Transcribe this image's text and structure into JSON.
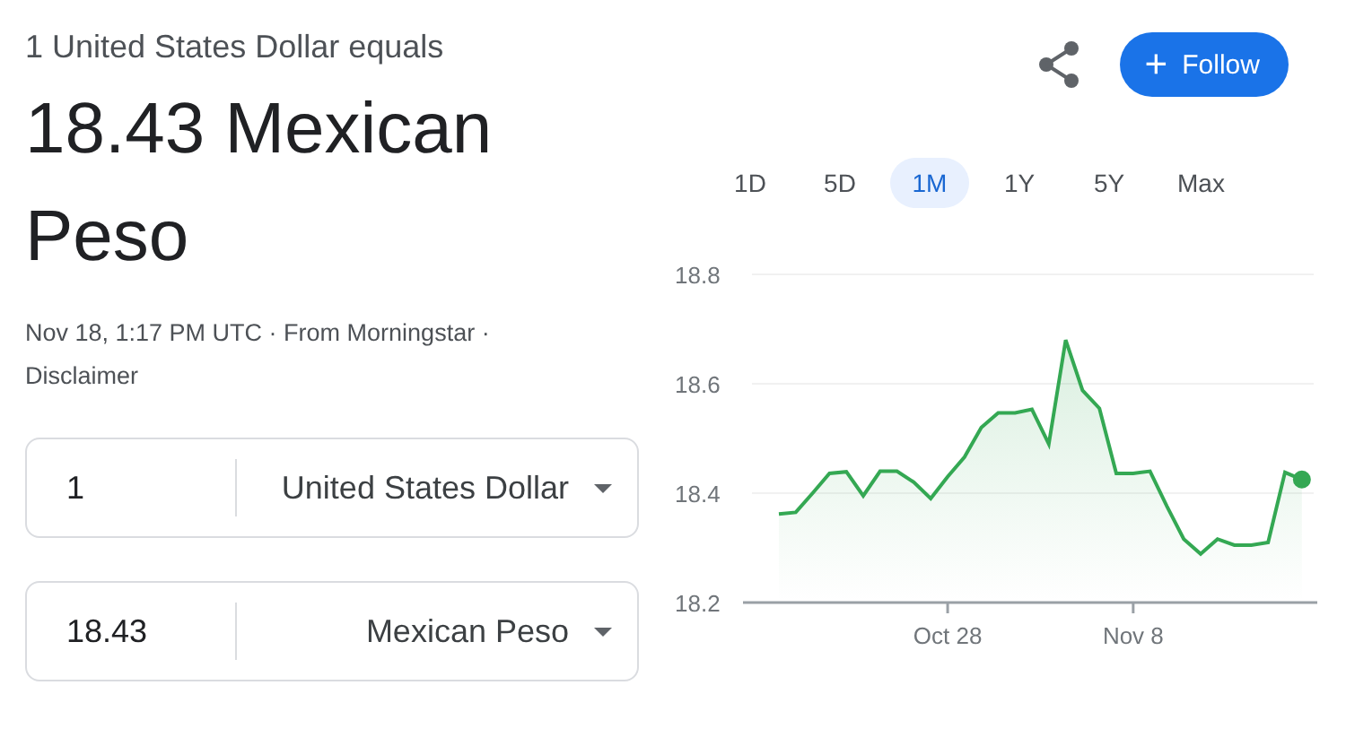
{
  "header": {
    "subtitle": "1 United States Dollar equals",
    "rate": "18.43 Mexican Peso"
  },
  "follow_button": {
    "icon": "+",
    "label": "Follow"
  },
  "source": {
    "text": "Nov 18, 1:17 PM UTC · From Morningstar ·",
    "link": "Disclaimer"
  },
  "converter": [
    {
      "amount": "1",
      "currency": "United States Dollar"
    },
    {
      "amount": "18.43",
      "currency": "Mexican Peso"
    }
  ],
  "ranges": [
    {
      "label": "1D",
      "selected": false
    },
    {
      "label": "5D",
      "selected": false
    },
    {
      "label": "1M",
      "selected": true
    },
    {
      "label": "1Y",
      "selected": false
    },
    {
      "label": "5Y",
      "selected": false
    },
    {
      "label": "Max",
      "selected": false
    }
  ],
  "chart": {
    "chart_data": {
      "type": "area",
      "categories": [
        null,
        null,
        null,
        null,
        null,
        null,
        null,
        null,
        null,
        null,
        "Oct 28",
        null,
        null,
        null,
        null,
        null,
        null,
        null,
        null,
        null,
        null,
        "Nov 8",
        null,
        null,
        null,
        null,
        null,
        null,
        null,
        null,
        null,
        null
      ],
      "series": [
        {
          "color": "#34a853",
          "values": [
            18.362,
            18.365,
            18.4,
            18.436,
            18.439,
            18.395,
            18.44,
            18.44,
            18.42,
            18.39,
            18.43,
            18.466,
            18.52,
            18.547,
            18.547,
            18.553,
            18.49,
            18.68,
            18.588,
            18.555,
            18.436,
            18.436,
            18.44,
            18.376,
            18.316,
            18.289,
            18.316,
            18.305,
            18.305,
            18.31,
            18.438,
            18.425
          ]
        }
      ],
      "ylim": [
        18.2,
        18.8
      ],
      "yticks": [
        18.2,
        18.4,
        18.6,
        18.8
      ]
    }
  }
}
